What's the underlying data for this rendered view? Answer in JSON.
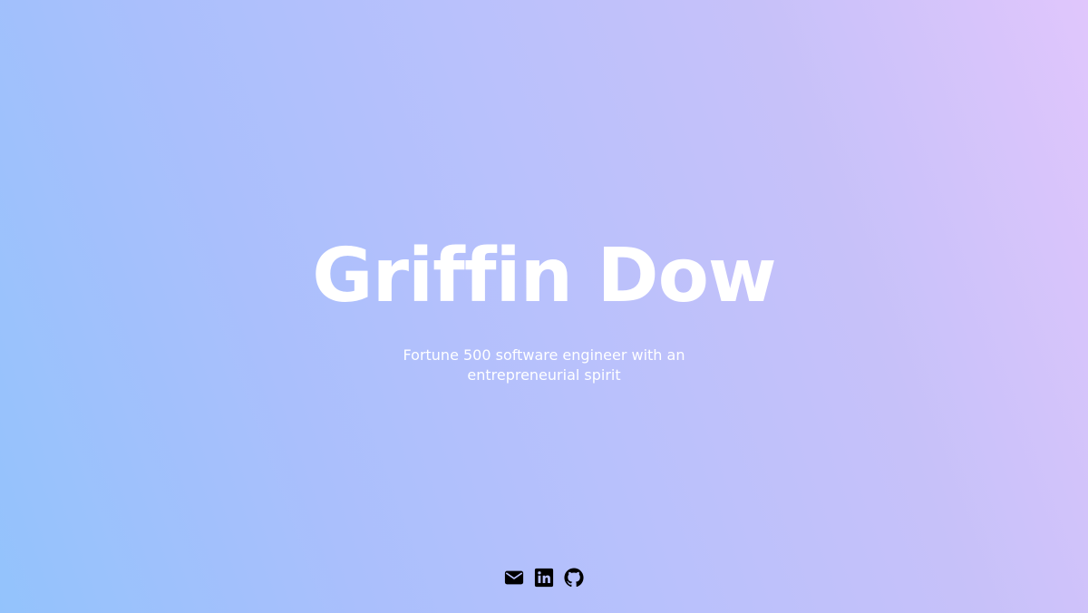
{
  "hero": {
    "name": "Griffin Dow",
    "tagline": "Fortune 500 software engineer with an entrepreneurial spirit"
  },
  "social": [
    {
      "icon": "email-icon"
    },
    {
      "icon": "linkedin-icon"
    },
    {
      "icon": "github-icon"
    }
  ],
  "colors": {
    "gradient_start": "#93c3fc",
    "gradient_end": "#e0c6fc",
    "text": "#ffffff",
    "icons": "#000000"
  }
}
